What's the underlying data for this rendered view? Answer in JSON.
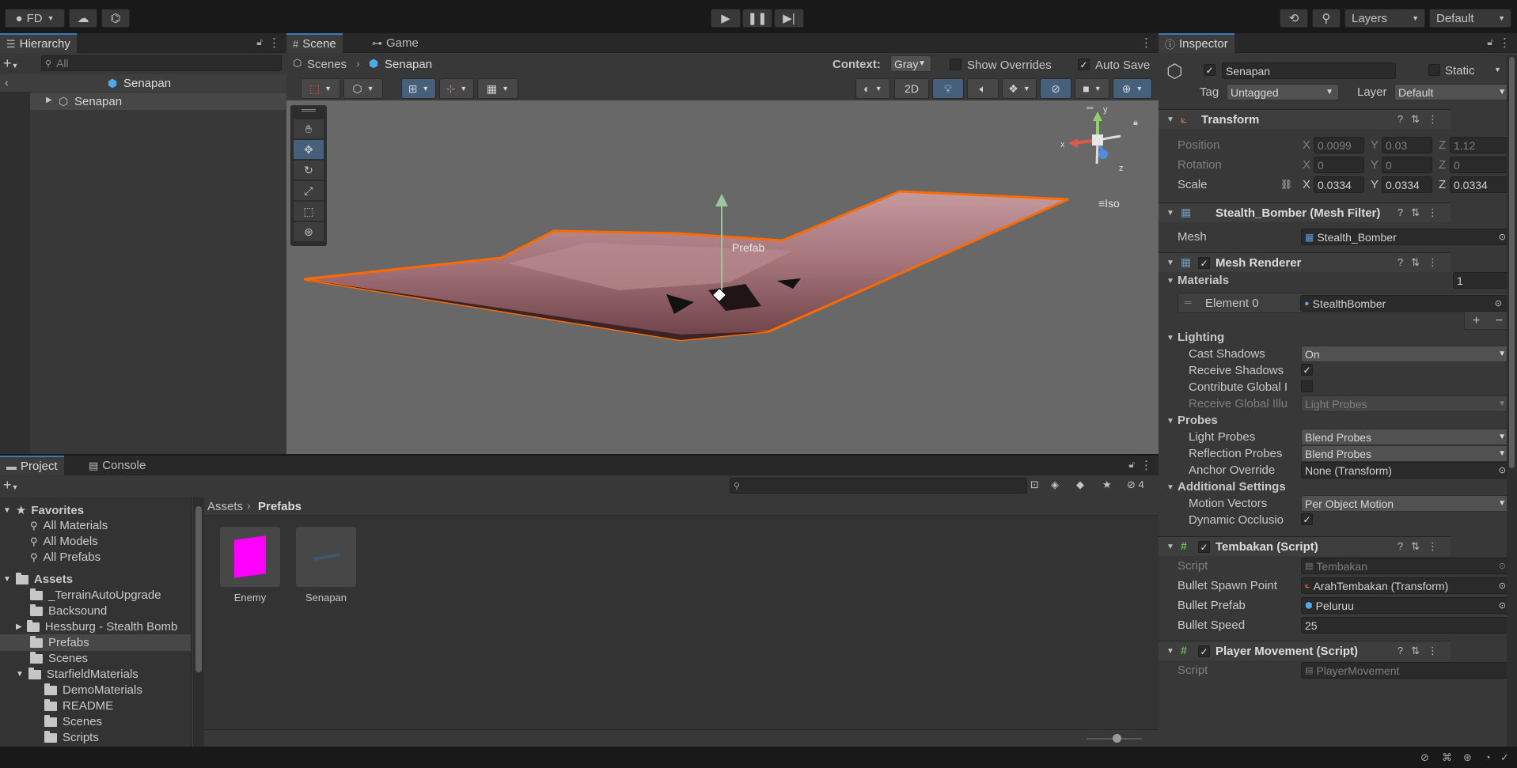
{
  "toolbar": {
    "account": "FD",
    "layers": "Layers",
    "layout": "Default"
  },
  "hierarchy": {
    "tab": "Hierarchy",
    "search_placeholder": "All",
    "scene_name": "Senapan",
    "items": [
      {
        "label": "Senapan"
      }
    ]
  },
  "scene_view": {
    "tabs": [
      "Scene",
      "Game"
    ],
    "breadcrumb": [
      "Scenes",
      "Senapan"
    ],
    "context_label": "Context:",
    "context_value": "Gray",
    "show_overrides": "Show Overrides",
    "auto_save": "Auto Save",
    "mode_2d": "2D",
    "gizmo_label": "Iso",
    "gizmo_axes": [
      "y",
      "x",
      "z"
    ],
    "prefab_label": "Prefab"
  },
  "project": {
    "tabs": [
      "Project",
      "Console"
    ],
    "hidden_count": "4",
    "favorites": {
      "label": "Favorites",
      "items": [
        "All Materials",
        "All Models",
        "All Prefabs"
      ]
    },
    "assets": {
      "label": "Assets",
      "items": [
        "_TerrainAutoUpgrade",
        "Backsound",
        "Hessburg - Stealth Bomb",
        "Prefabs",
        "Scenes",
        "StarfieldMaterials"
      ],
      "sub_items": [
        "DemoMaterials",
        "README",
        "Scenes",
        "Scripts"
      ]
    },
    "breadcrumb": [
      "Assets",
      "Prefabs"
    ],
    "grid_items": [
      {
        "label": "Enemy"
      },
      {
        "label": "Senapan"
      }
    ]
  },
  "inspector": {
    "tab": "Inspector",
    "object_name": "Senapan",
    "static_label": "Static",
    "tag_label": "Tag",
    "tag_value": "Untagged",
    "layer_label": "Layer",
    "layer_value": "Default",
    "transform": {
      "title": "Transform",
      "position_label": "Position",
      "rotation_label": "Rotation",
      "scale_label": "Scale",
      "position": {
        "x": "0.0099",
        "y": "0.03",
        "z": "1.12"
      },
      "rotation": {
        "x": "0",
        "y": "0",
        "z": "0"
      },
      "scale": {
        "x": "0.0334",
        "y": "0.0334",
        "z": "0.0334"
      }
    },
    "mesh_filter": {
      "title": "Stealth_Bomber (Mesh Filter)",
      "mesh_label": "Mesh",
      "mesh_value": "Stealth_Bomber"
    },
    "mesh_renderer": {
      "title": "Mesh Renderer",
      "materials_label": "Materials",
      "materials_count": "1",
      "element_label": "Element 0",
      "element_value": "StealthBomber",
      "lighting_label": "Lighting",
      "cast_shadows_label": "Cast Shadows",
      "cast_shadows_value": "On",
      "receive_shadows_label": "Receive Shadows",
      "contribute_gi_label": "Contribute Global I",
      "receive_gi_label": "Receive Global Illu",
      "receive_gi_value": "Light Probes",
      "probes_label": "Probes",
      "light_probes_label": "Light Probes",
      "light_probes_value": "Blend Probes",
      "reflection_probes_label": "Reflection Probes",
      "reflection_probes_value": "Blend Probes",
      "anchor_override_label": "Anchor Override",
      "anchor_override_value": "None (Transform)",
      "additional_label": "Additional Settings",
      "motion_vectors_label": "Motion Vectors",
      "motion_vectors_value": "Per Object Motion",
      "dynamic_occlusion_label": "Dynamic Occlusio"
    },
    "tembakan": {
      "title": "Tembakan (Script)",
      "script_label": "Script",
      "script_value": "Tembakan",
      "spawn_label": "Bullet Spawn Point",
      "spawn_value": "ArahTembakan (Transform)",
      "prefab_label": "Bullet Prefab",
      "prefab_value": "Peluruu",
      "speed_label": "Bullet Speed",
      "speed_value": "25"
    },
    "player_movement": {
      "title": "Player Movement (Script)",
      "script_label": "Script",
      "script_value": "PlayerMovement"
    }
  },
  "colors": {
    "accent_blue": "#3a79bb",
    "selection_orange": "#ff6a00",
    "prefab_blue": "#4fa8e8",
    "enemy_magenta": "#ff00ff"
  }
}
